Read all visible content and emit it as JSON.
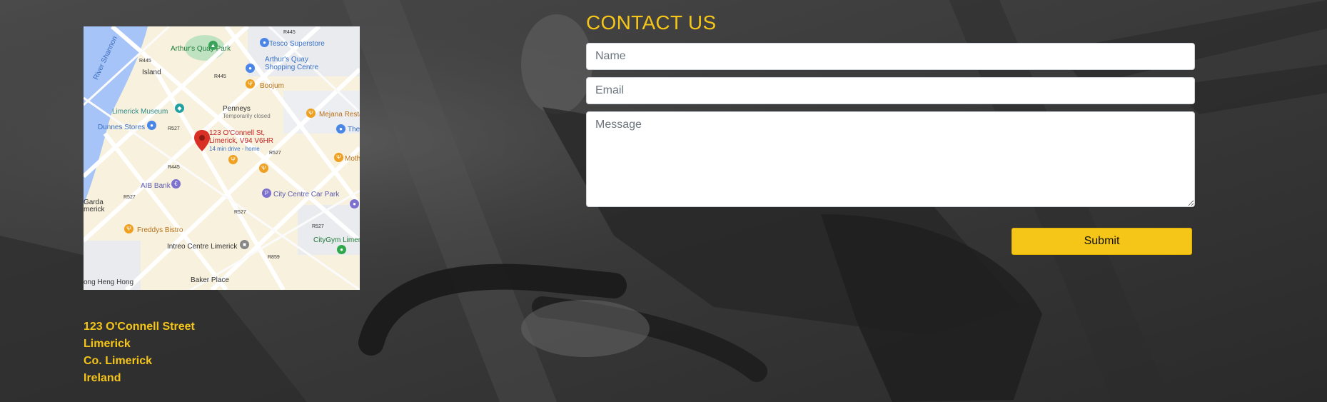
{
  "page": {
    "accent_color": "#f5c518",
    "background_description_color": "#3a3a3a"
  },
  "map": {
    "pin_label_line1": "123 O'Connell St,",
    "pin_label_line2": "Limerick, V94 V6HR",
    "pin_sublabel": "14 min drive - home",
    "labels": {
      "arthurs_quay_park": "Arthur's Quay Park",
      "tesco": "Tesco Superstore",
      "arthurs_quay_centre_1": "Arthur's Quay",
      "arthurs_quay_centre_2": "Shopping Centre",
      "river_shannon": "River Shannon",
      "island": "Island",
      "boojum": "Boojum",
      "limerick_museum": "Limerick Museum",
      "penneys": "Penneys",
      "penneys_status": "Temporarily closed",
      "mejana": "Mejana Resta",
      "dunnes": "Dunnes Stores",
      "the": "The",
      "moth": "Moth",
      "aib": "AIB Bank",
      "city_centre_car_park": "City Centre Car Park",
      "garda_1": "Garda",
      "garda_2": "merick",
      "freddys": "Freddys Bistro",
      "intreo": "Intreo Centre Limerick",
      "citygym": "CityGym Limer",
      "hong": "ong Heng Hong",
      "baker": "Baker Place",
      "r445a": "R445",
      "r445b": "R445",
      "r445c": "R445",
      "r445d": "R445",
      "r527a": "R527",
      "r527b": "R527",
      "r527c": "R527",
      "r527d": "R527",
      "r527e": "R527",
      "r527f": "R527",
      "r859": "R859"
    }
  },
  "address": {
    "line1": "123 O'Connell Street",
    "line2": "Limerick",
    "line3": "Co. Limerick",
    "line4": "Ireland"
  },
  "contact": {
    "title": "CONTACT US",
    "name_placeholder": "Name",
    "email_placeholder": "Email",
    "message_placeholder": "Message",
    "submit_label": "Submit"
  }
}
